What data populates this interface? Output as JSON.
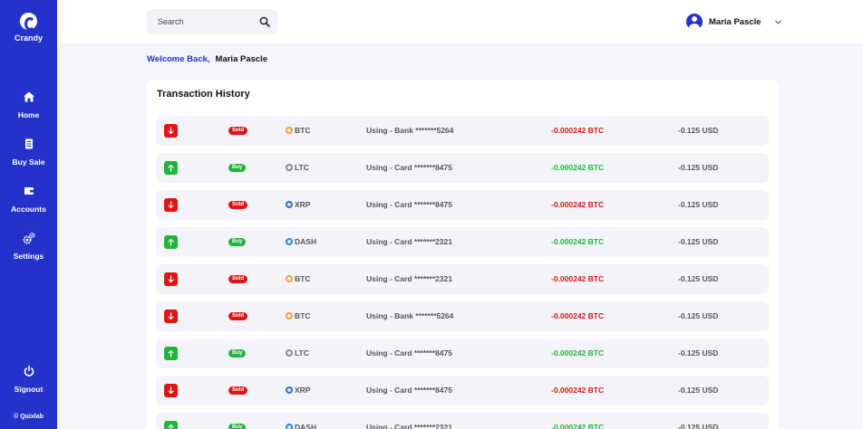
{
  "brand": {
    "name": "Crandy"
  },
  "sidebar": {
    "items": [
      {
        "label": "Home",
        "icon": "home-icon"
      },
      {
        "label": "Buy Sale",
        "icon": "receipt-icon"
      },
      {
        "label": "Accounts",
        "icon": "wallet-icon"
      },
      {
        "label": "Settings",
        "icon": "gears-icon"
      }
    ],
    "signout_label": "Signout",
    "copyright": "© Quixlab"
  },
  "search": {
    "placeholder": "Search",
    "value": ""
  },
  "user": {
    "name": "Maria Pascle"
  },
  "welcome": {
    "label": "Welcome Back,",
    "name": "Maria Pascle"
  },
  "transactions": {
    "title": "Transaction History",
    "colors": {
      "sold": "#e01414",
      "buy": "#1eb53a",
      "brand": "#2332c8"
    },
    "rows": [
      {
        "direction": "down",
        "type": "Sold",
        "coin": "BTC",
        "method": "Using - Bank *******5264",
        "amount": "-0.000242 BTC",
        "usd": "-0.125 USD"
      },
      {
        "direction": "up",
        "type": "Buy",
        "coin": "LTC",
        "method": "Using - Card *******8475",
        "amount": "-0.000242 BTC",
        "usd": "-0.125 USD"
      },
      {
        "direction": "down",
        "type": "Sold",
        "coin": "XRP",
        "method": "Using - Card *******8475",
        "amount": "-0.000242 BTC",
        "usd": "-0.125 USD"
      },
      {
        "direction": "up",
        "type": "Buy",
        "coin": "DASH",
        "method": "Using - Card *******2321",
        "amount": "-0.000242 BTC",
        "usd": "-0.125 USD"
      },
      {
        "direction": "down",
        "type": "Sold",
        "coin": "BTC",
        "method": "Using - Card *******2321",
        "amount": "-0.000242 BTC",
        "usd": "-0.125 USD"
      },
      {
        "direction": "down",
        "type": "Sold",
        "coin": "BTC",
        "method": "Using - Bank *******5264",
        "amount": "-0.000242 BTC",
        "usd": "-0.125 USD"
      },
      {
        "direction": "up",
        "type": "Buy",
        "coin": "LTC",
        "method": "Using - Card *******8475",
        "amount": "-0.000242 BTC",
        "usd": "-0.125 USD"
      },
      {
        "direction": "down",
        "type": "Sold",
        "coin": "XRP",
        "method": "Using - Card *******8475",
        "amount": "-0.000242 BTC",
        "usd": "-0.125 USD"
      },
      {
        "direction": "up",
        "type": "Buy",
        "coin": "DASH",
        "method": "Using - Card *******2321",
        "amount": "-0.000242 BTC",
        "usd": "-0.125 USD"
      }
    ]
  },
  "coin_colors": {
    "BTC": "#f2a23a",
    "LTC": "#8a8a8a",
    "XRP": "#3a6fb0",
    "DASH": "#2a86d6"
  }
}
